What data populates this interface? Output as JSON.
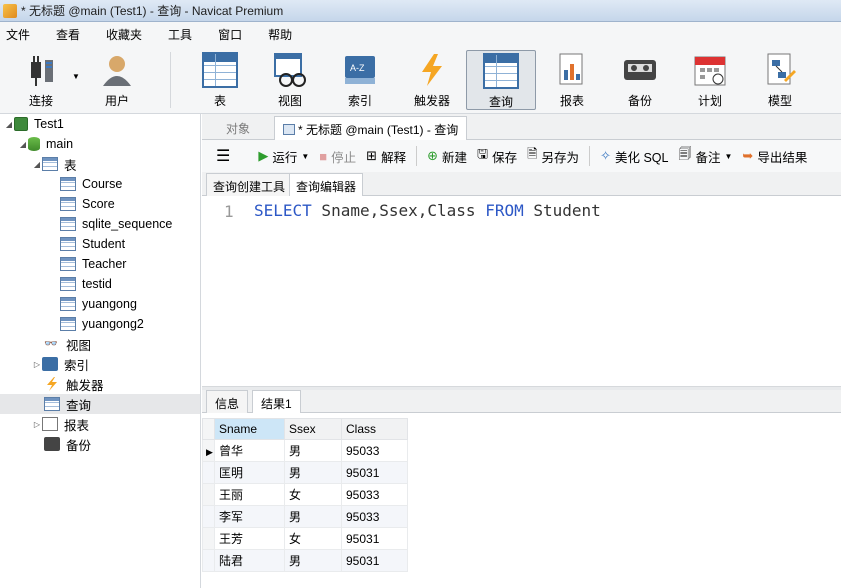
{
  "window": {
    "title": "* 无标题 @main (Test1) - 查询 - Navicat Premium"
  },
  "menu": [
    "文件",
    "查看",
    "收藏夹",
    "工具",
    "窗口",
    "帮助"
  ],
  "toolbar": {
    "connect": "连接",
    "user": "用户",
    "table": "表",
    "view": "视图",
    "index": "索引",
    "trigger": "触发器",
    "query": "查询",
    "report": "报表",
    "backup": "备份",
    "schedule": "计划",
    "model": "模型",
    "index_icon_text": "A-Z"
  },
  "tree": {
    "connection": "Test1",
    "database": "main",
    "tables_group": "表",
    "tables": [
      "Course",
      "Score",
      "sqlite_sequence",
      "Student",
      "Teacher",
      "testid",
      "yuangong",
      "yuangong2"
    ],
    "views": "视图",
    "indexes": "索引",
    "triggers": "触发器",
    "queries": "查询",
    "reports": "报表",
    "backups": "备份"
  },
  "tabs": {
    "objects": "对象",
    "query_tab": "* 无标题 @main (Test1) - 查询"
  },
  "query_toolbar": {
    "run": "运行",
    "stop": "停止",
    "explain": "解释",
    "new": "新建",
    "save": "保存",
    "save_as": "另存为",
    "beautify": "美化 SQL",
    "comment": "备注",
    "export": "导出结果"
  },
  "subtabs": {
    "builder": "查询创建工具",
    "editor": "查询编辑器"
  },
  "editor": {
    "line_number": "1",
    "kw_select": "SELECT",
    "columns": " Sname,Ssex,Class ",
    "kw_from": "FROM",
    "table": " Student"
  },
  "result_tabs": {
    "info": "信息",
    "result1": "结果1"
  },
  "result_grid": {
    "columns": [
      "Sname",
      "Ssex",
      "Class"
    ],
    "rows": [
      [
        "曾华",
        "男",
        "95033"
      ],
      [
        "匡明",
        "男",
        "95031"
      ],
      [
        "王丽",
        "女",
        "95033"
      ],
      [
        "李军",
        "男",
        "95033"
      ],
      [
        "王芳",
        "女",
        "95031"
      ],
      [
        "陆君",
        "男",
        "95031"
      ]
    ]
  }
}
